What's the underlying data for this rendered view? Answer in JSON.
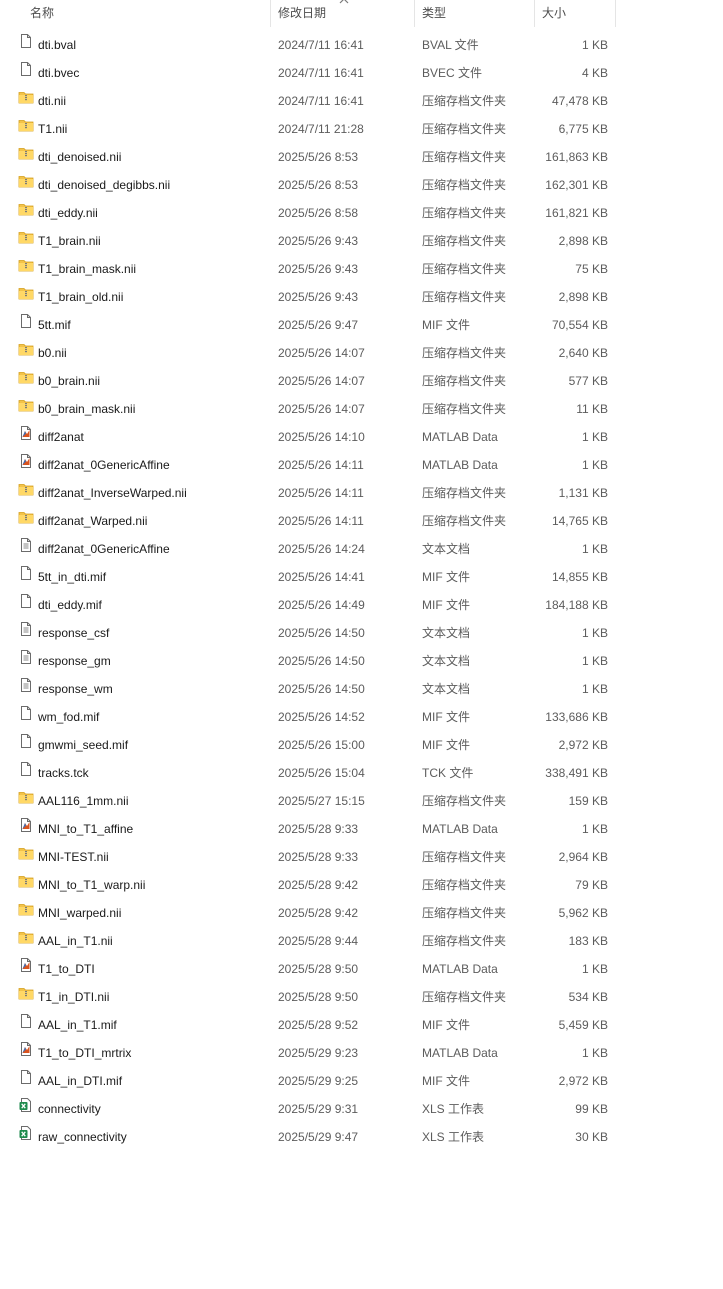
{
  "columns": {
    "name": "名称",
    "date": "修改日期",
    "type": "类型",
    "size": "大小"
  },
  "sort": {
    "column": "date",
    "direction": "ascending"
  },
  "files": [
    {
      "name": "dti.bval",
      "date": "2024/7/11 16:41",
      "type": "BVAL 文件",
      "size": "1 KB",
      "icon": "doc"
    },
    {
      "name": "dti.bvec",
      "date": "2024/7/11 16:41",
      "type": "BVEC 文件",
      "size": "4 KB",
      "icon": "doc"
    },
    {
      "name": "dti.nii",
      "date": "2024/7/11 16:41",
      "type": "压缩存档文件夹",
      "size": "47,478 KB",
      "icon": "zip"
    },
    {
      "name": "T1.nii",
      "date": "2024/7/11 21:28",
      "type": "压缩存档文件夹",
      "size": "6,775 KB",
      "icon": "zip"
    },
    {
      "name": "dti_denoised.nii",
      "date": "2025/5/26 8:53",
      "type": "压缩存档文件夹",
      "size": "161,863 KB",
      "icon": "zip"
    },
    {
      "name": "dti_denoised_degibbs.nii",
      "date": "2025/5/26 8:53",
      "type": "压缩存档文件夹",
      "size": "162,301 KB",
      "icon": "zip"
    },
    {
      "name": "dti_eddy.nii",
      "date": "2025/5/26 8:58",
      "type": "压缩存档文件夹",
      "size": "161,821 KB",
      "icon": "zip"
    },
    {
      "name": "T1_brain.nii",
      "date": "2025/5/26 9:43",
      "type": "压缩存档文件夹",
      "size": "2,898 KB",
      "icon": "zip"
    },
    {
      "name": "T1_brain_mask.nii",
      "date": "2025/5/26 9:43",
      "type": "压缩存档文件夹",
      "size": "75 KB",
      "icon": "zip"
    },
    {
      "name": "T1_brain_old.nii",
      "date": "2025/5/26 9:43",
      "type": "压缩存档文件夹",
      "size": "2,898 KB",
      "icon": "zip"
    },
    {
      "name": "5tt.mif",
      "date": "2025/5/26 9:47",
      "type": "MIF 文件",
      "size": "70,554 KB",
      "icon": "doc"
    },
    {
      "name": "b0.nii",
      "date": "2025/5/26 14:07",
      "type": "压缩存档文件夹",
      "size": "2,640 KB",
      "icon": "zip"
    },
    {
      "name": "b0_brain.nii",
      "date": "2025/5/26 14:07",
      "type": "压缩存档文件夹",
      "size": "577 KB",
      "icon": "zip"
    },
    {
      "name": "b0_brain_mask.nii",
      "date": "2025/5/26 14:07",
      "type": "压缩存档文件夹",
      "size": "11 KB",
      "icon": "zip"
    },
    {
      "name": "diff2anat",
      "date": "2025/5/26 14:10",
      "type": "MATLAB Data",
      "size": "1 KB",
      "icon": "mat"
    },
    {
      "name": "diff2anat_0GenericAffine",
      "date": "2025/5/26 14:11",
      "type": "MATLAB Data",
      "size": "1 KB",
      "icon": "mat"
    },
    {
      "name": "diff2anat_InverseWarped.nii",
      "date": "2025/5/26 14:11",
      "type": "压缩存档文件夹",
      "size": "1,131 KB",
      "icon": "zip"
    },
    {
      "name": "diff2anat_Warped.nii",
      "date": "2025/5/26 14:11",
      "type": "压缩存档文件夹",
      "size": "14,765 KB",
      "icon": "zip"
    },
    {
      "name": "diff2anat_0GenericAffine",
      "date": "2025/5/26 14:24",
      "type": "文本文档",
      "size": "1 KB",
      "icon": "txt"
    },
    {
      "name": "5tt_in_dti.mif",
      "date": "2025/5/26 14:41",
      "type": "MIF 文件",
      "size": "14,855 KB",
      "icon": "doc"
    },
    {
      "name": "dti_eddy.mif",
      "date": "2025/5/26 14:49",
      "type": "MIF 文件",
      "size": "184,188 KB",
      "icon": "doc"
    },
    {
      "name": "response_csf",
      "date": "2025/5/26 14:50",
      "type": "文本文档",
      "size": "1 KB",
      "icon": "txt"
    },
    {
      "name": "response_gm",
      "date": "2025/5/26 14:50",
      "type": "文本文档",
      "size": "1 KB",
      "icon": "txt"
    },
    {
      "name": "response_wm",
      "date": "2025/5/26 14:50",
      "type": "文本文档",
      "size": "1 KB",
      "icon": "txt"
    },
    {
      "name": "wm_fod.mif",
      "date": "2025/5/26 14:52",
      "type": "MIF 文件",
      "size": "133,686 KB",
      "icon": "doc"
    },
    {
      "name": "gmwmi_seed.mif",
      "date": "2025/5/26 15:00",
      "type": "MIF 文件",
      "size": "2,972 KB",
      "icon": "doc"
    },
    {
      "name": "tracks.tck",
      "date": "2025/5/26 15:04",
      "type": "TCK 文件",
      "size": "338,491 KB",
      "icon": "doc"
    },
    {
      "name": "AAL116_1mm.nii",
      "date": "2025/5/27 15:15",
      "type": "压缩存档文件夹",
      "size": "159 KB",
      "icon": "zip"
    },
    {
      "name": "MNI_to_T1_affine",
      "date": "2025/5/28 9:33",
      "type": "MATLAB Data",
      "size": "1 KB",
      "icon": "mat"
    },
    {
      "name": "MNI-TEST.nii",
      "date": "2025/5/28 9:33",
      "type": "压缩存档文件夹",
      "size": "2,964 KB",
      "icon": "zip"
    },
    {
      "name": "MNI_to_T1_warp.nii",
      "date": "2025/5/28 9:42",
      "type": "压缩存档文件夹",
      "size": "79 KB",
      "icon": "zip"
    },
    {
      "name": "MNI_warped.nii",
      "date": "2025/5/28 9:42",
      "type": "压缩存档文件夹",
      "size": "5,962 KB",
      "icon": "zip"
    },
    {
      "name": "AAL_in_T1.nii",
      "date": "2025/5/28 9:44",
      "type": "压缩存档文件夹",
      "size": "183 KB",
      "icon": "zip"
    },
    {
      "name": "T1_to_DTI",
      "date": "2025/5/28 9:50",
      "type": "MATLAB Data",
      "size": "1 KB",
      "icon": "mat"
    },
    {
      "name": "T1_in_DTI.nii",
      "date": "2025/5/28 9:50",
      "type": "压缩存档文件夹",
      "size": "534 KB",
      "icon": "zip"
    },
    {
      "name": "AAL_in_T1.mif",
      "date": "2025/5/28 9:52",
      "type": "MIF 文件",
      "size": "5,459 KB",
      "icon": "doc"
    },
    {
      "name": "T1_to_DTI_mrtrix",
      "date": "2025/5/29 9:23",
      "type": "MATLAB Data",
      "size": "1 KB",
      "icon": "mat"
    },
    {
      "name": "AAL_in_DTI.mif",
      "date": "2025/5/29 9:25",
      "type": "MIF 文件",
      "size": "2,972 KB",
      "icon": "doc"
    },
    {
      "name": "connectivity",
      "date": "2025/5/29 9:31",
      "type": "XLS 工作表",
      "size": "99 KB",
      "icon": "xls"
    },
    {
      "name": "raw_connectivity",
      "date": "2025/5/29 9:47",
      "type": "XLS 工作表",
      "size": "30 KB",
      "icon": "xls"
    }
  ]
}
